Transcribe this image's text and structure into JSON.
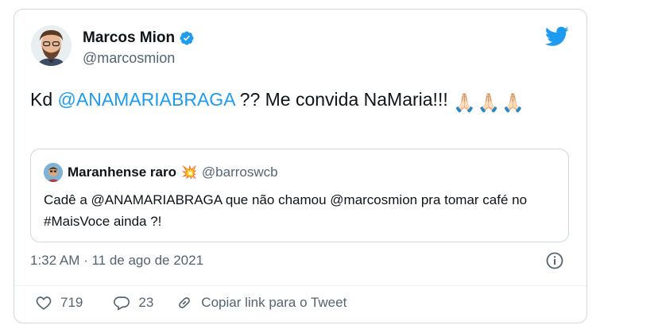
{
  "author": {
    "name": "Marcos Mion",
    "handle": "@marcosmion"
  },
  "tweet": {
    "text_before": "Kd ",
    "mention": "@ANAMARIABRAGA",
    "text_after": " ?? Me convida NaMaria!!! ",
    "emoji": [
      "🙏🏻",
      "🙏🏻",
      "🙏🏻"
    ]
  },
  "quote": {
    "name": "Maranhense raro",
    "badge_emoji": "💥",
    "handle": "@barroswcb",
    "text": "Cadê a @ANAMARIABRAGA que não chamou @marcosmion pra tomar café no #MaisVoce ainda ?!"
  },
  "meta": {
    "timestamp": "1:32 AM · 11 de ago de 2021"
  },
  "actions": {
    "likes": "719",
    "replies": "23",
    "copy_link": "Copiar link para o Tweet"
  },
  "icons": [
    "verified-badge-icon",
    "twitter-bird-icon",
    "info-icon",
    "heart-icon",
    "reply-icon",
    "link-icon"
  ],
  "colors": {
    "accent": "#1d9bf0",
    "secondary_text": "#536471",
    "border": "#cfd9de"
  }
}
